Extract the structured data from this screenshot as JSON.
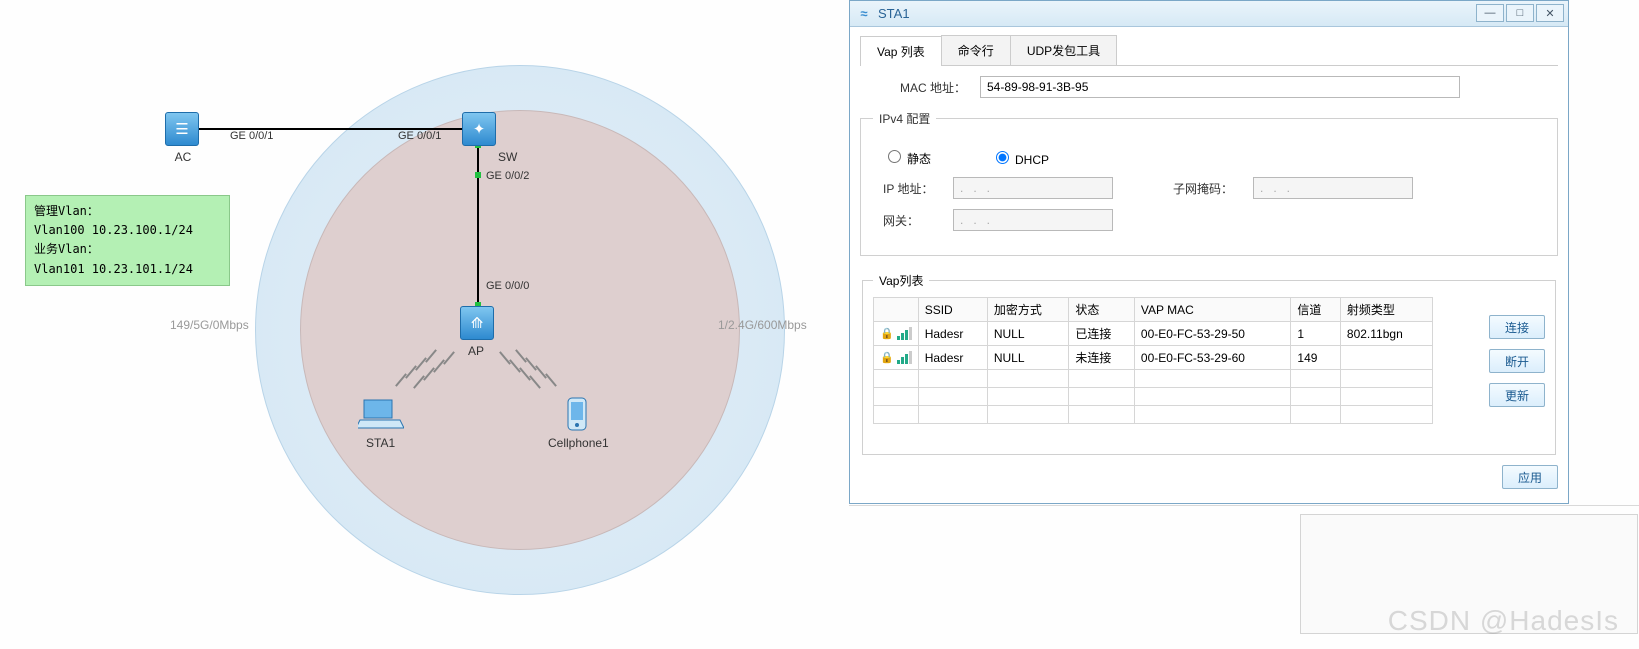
{
  "window": {
    "title": "STA1",
    "buttons": {
      "min": "—",
      "max": "□",
      "close": "✕"
    }
  },
  "tabs": [
    {
      "label": "Vap 列表",
      "active": true
    },
    {
      "label": "命令行",
      "active": false
    },
    {
      "label": "UDP发包工具",
      "active": false
    }
  ],
  "mac": {
    "label": "MAC 地址：",
    "value": "54-89-98-91-3B-95"
  },
  "ipv4": {
    "legend": "IPv4 配置",
    "static_label": "静态",
    "dhcp_label": "DHCP",
    "selected": "dhcp",
    "ip_label": "IP 地址：",
    "mask_label": "子网掩码：",
    "gw_label": "网关：",
    "ip_val": ".   .   .",
    "mask_val": ".   .   .",
    "gw_val": ".   .   ."
  },
  "vap": {
    "legend": "Vap列表",
    "headers": [
      "",
      "SSID",
      "加密方式",
      "状态",
      "VAP MAC",
      "信道",
      "射频类型"
    ],
    "rows": [
      {
        "ssid": "Hadesr",
        "enc": "NULL",
        "status": "已连接",
        "mac": "00-E0-FC-53-29-50",
        "ch": "1",
        "rf": "802.11bgn"
      },
      {
        "ssid": "Hadesr",
        "enc": "NULL",
        "status": "未连接",
        "mac": "00-E0-FC-53-29-60",
        "ch": "149",
        "rf": ""
      }
    ],
    "buttons": {
      "connect": "连接",
      "disconnect": "断开",
      "refresh": "更新"
    },
    "apply": "应用"
  },
  "topology": {
    "devices": {
      "ac": {
        "label": "AC"
      },
      "sw": {
        "label": "SW"
      },
      "ap": {
        "label": "AP"
      },
      "sta": {
        "label": "STA1"
      },
      "phone": {
        "label": "Cellphone1"
      }
    },
    "ports": {
      "ac_sw_left": "GE 0/0/1",
      "ac_sw_right": "GE 0/0/1",
      "sw_down": "GE 0/0/2",
      "ap_up": "GE 0/0/0"
    },
    "side_left": "149/5G/0Mbps",
    "side_right": "1/2.4G/600Mbps",
    "vlan_box": {
      "l1": "管理Vlan：",
      "l2": "Vlan100   10.23.100.1/24",
      "l3": "",
      "l4": "业务Vlan：",
      "l5": "Vlan101   10.23.101.1/24"
    }
  },
  "watermark": "CSDN @HadesIs"
}
